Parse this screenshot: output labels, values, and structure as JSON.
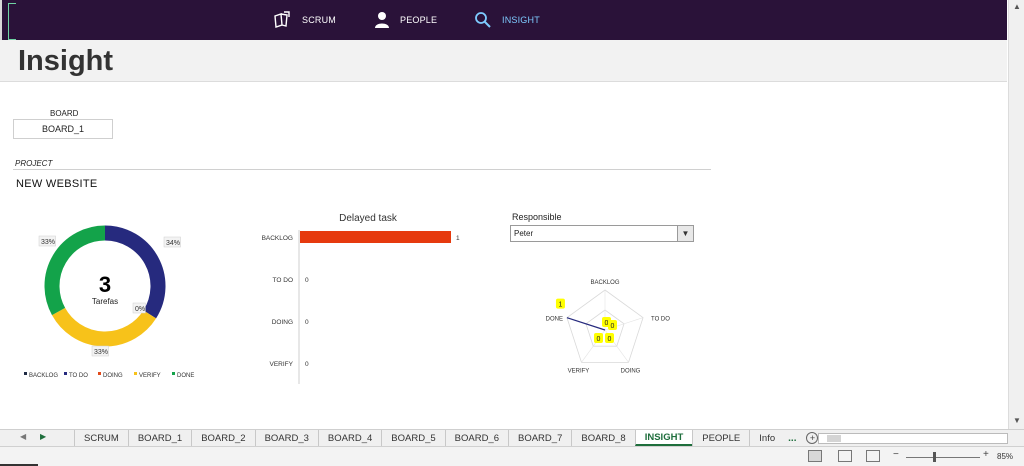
{
  "nav": {
    "items": [
      {
        "label": "SCRUM",
        "icon": "scrum-icon"
      },
      {
        "label": "PEOPLE",
        "icon": "person-icon"
      },
      {
        "label": "INSIGHT",
        "icon": "search-icon",
        "active": true
      }
    ]
  },
  "page": {
    "title": "Insight",
    "board_label": "BOARD",
    "board_value": "BOARD_1",
    "project_label": "PROJECT",
    "project_name": "NEW WEBSITE"
  },
  "colors": {
    "backlog": "#1f2a44",
    "todo": "#262a7e",
    "doing": "#e24a1a",
    "verify": "#f7c21a",
    "done": "#13a34a",
    "bar": "#e63a0e",
    "highlight": "#ffff00",
    "nav_bg": "#2a1239"
  },
  "chart_data": [
    {
      "type": "pie",
      "variant": "donut",
      "center_value": "3",
      "center_label": "Tarefas",
      "categories": [
        "BACKLOG",
        "TO DO",
        "DOING",
        "VERIFY",
        "DONE"
      ],
      "values": [
        0,
        34,
        0,
        33,
        33
      ],
      "data_labels": [
        "",
        "34%",
        "0%",
        "33%",
        "33%"
      ],
      "legend_placement": "bottom"
    },
    {
      "type": "bar",
      "orientation": "horizontal",
      "title": "Delayed task",
      "categories": [
        "BACKLOG",
        "TO DO",
        "DOING",
        "VERIFY"
      ],
      "values": [
        1,
        0,
        0,
        0
      ],
      "xlim": [
        0,
        1
      ],
      "grid": false
    },
    {
      "type": "radar",
      "categories": [
        "BACKLOG",
        "TO DO",
        "DOING",
        "VERIFY",
        "DONE"
      ],
      "values": [
        0,
        0,
        0,
        0,
        1
      ],
      "data_labels": [
        "0",
        "0",
        "0",
        "0",
        "1"
      ],
      "rlim": [
        0,
        1
      ]
    }
  ],
  "responsible": {
    "label": "Responsible",
    "value": "Peter"
  },
  "sheets": {
    "tabs": [
      "SCRUM",
      "BOARD_1",
      "BOARD_2",
      "BOARD_3",
      "BOARD_4",
      "BOARD_5",
      "BOARD_6",
      "BOARD_7",
      "BOARD_8",
      "INSIGHT",
      "PEOPLE",
      "Info"
    ],
    "active": "INSIGHT",
    "more": "..."
  },
  "status": {
    "zoom": "85%"
  }
}
